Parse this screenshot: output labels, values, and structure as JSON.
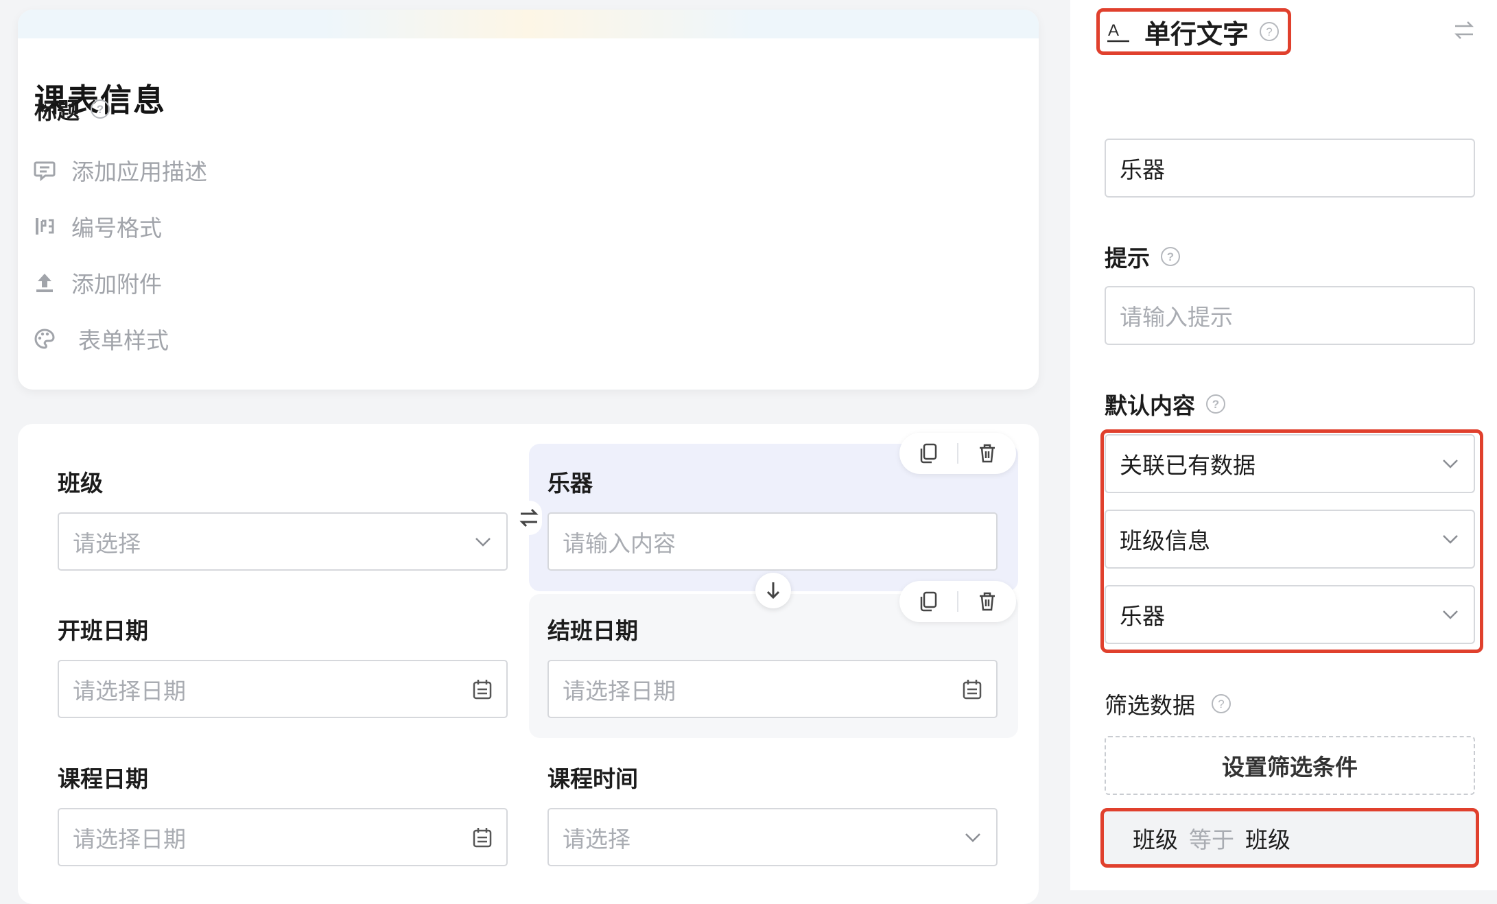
{
  "app": {
    "title": "课表信息",
    "options": [
      {
        "label": "添加应用描述",
        "icon": "comment-icon"
      },
      {
        "label": "编号格式",
        "icon": "number-format-icon"
      },
      {
        "label": "添加附件",
        "icon": "upload-icon"
      },
      {
        "label": "表单样式",
        "icon": "palette-icon"
      }
    ]
  },
  "form": {
    "fields": [
      {
        "label": "班级",
        "placeholder": "请选择",
        "icon": "chevron-down-icon"
      },
      {
        "label": "乐器",
        "placeholder": "请输入内容",
        "icon": ""
      },
      {
        "label": "开班日期",
        "placeholder": "请选择日期",
        "icon": "calendar-icon"
      },
      {
        "label": "结班日期",
        "placeholder": "请选择日期",
        "icon": "calendar-icon"
      },
      {
        "label": "课程日期",
        "placeholder": "请选择日期",
        "icon": "calendar-icon"
      },
      {
        "label": "课程时间",
        "placeholder": "请选择",
        "icon": "chevron-down-icon"
      }
    ]
  },
  "panel": {
    "field_type": "单行文字",
    "title_label": "标题",
    "title_value": "乐器",
    "hint_label": "提示",
    "hint_placeholder": "请输入提示",
    "default_label": "默认内容",
    "default_selects": [
      "关联已有数据",
      "班级信息",
      "乐器"
    ],
    "filter_label": "筛选数据",
    "filter_button": "设置筛选条件",
    "condition": {
      "field": "班级",
      "operator": "等于",
      "value": "班级"
    }
  },
  "colors": {
    "accent_red": "#e0402d",
    "selected_bg": "#eef0fb",
    "placeholder": "#a9acb2"
  }
}
